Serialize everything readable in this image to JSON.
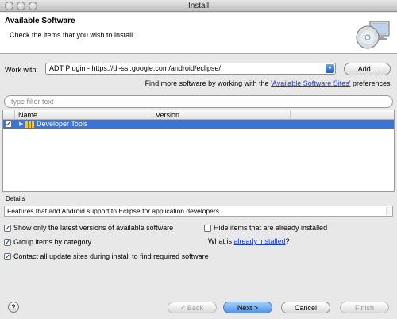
{
  "window": {
    "title": "Install"
  },
  "header": {
    "title": "Available Software",
    "subtitle": "Check the items that you wish to install."
  },
  "work_with": {
    "label": "Work with:",
    "value": "ADT Plugin - https://dl-ssl.google.com/android/eclipse/",
    "add_button": "Add..."
  },
  "find_more": {
    "prefix": "Find more software by working with the ",
    "link": "'Available Software Sites'",
    "suffix": " preferences."
  },
  "filter": {
    "placeholder": "type filter text"
  },
  "table": {
    "columns": [
      "Name",
      "Version"
    ],
    "rows": [
      {
        "name": "Developer Tools",
        "version": "",
        "checked": true
      }
    ]
  },
  "details": {
    "label": "Details",
    "text": "Features that add Android support to Eclipse for application developers."
  },
  "options": {
    "show_latest": "Show only the latest versions of available software",
    "hide_installed": "Hide items that are already installed",
    "group_by_category": "Group items by category",
    "what_is_prefix": "What is ",
    "what_is_link": "already installed",
    "what_is_suffix": "?",
    "contact_sites": "Contact all update sites during install to find required software"
  },
  "buttons": {
    "help": "?",
    "back": "< Back",
    "next": "Next >",
    "cancel": "Cancel",
    "finish": "Finish"
  },
  "colors": {
    "selection": "#3875d7",
    "link": "#1a3cc8"
  }
}
